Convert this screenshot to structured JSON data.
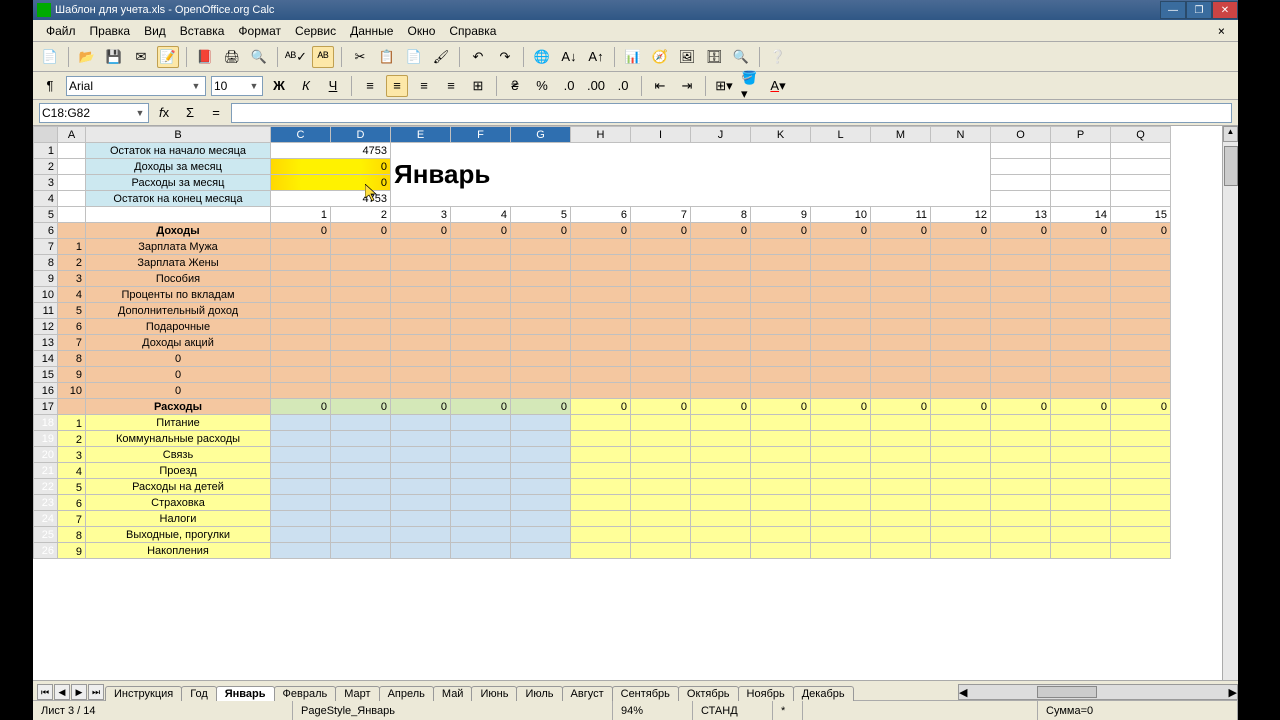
{
  "title": "Шаблон для учета.xls - OpenOffice.org Calc",
  "menu": [
    "Файл",
    "Правка",
    "Вид",
    "Вставка",
    "Формат",
    "Сервис",
    "Данные",
    "Окно",
    "Справка"
  ],
  "font": {
    "name": "Arial",
    "size": "10"
  },
  "cellref": "C18:G82",
  "formula": "",
  "cols": [
    "A",
    "B",
    "C",
    "D",
    "E",
    "F",
    "G",
    "H",
    "I",
    "J",
    "K",
    "L",
    "M",
    "N",
    "O",
    "P",
    "Q"
  ],
  "month_title": "Январь",
  "summary": [
    {
      "label": "Остаток на начало месяца",
      "val": "4753",
      "hl": false
    },
    {
      "label": "Доходы за месяц",
      "val": "0",
      "hl": true
    },
    {
      "label": "Расходы за месяц",
      "val": "0",
      "hl": true
    },
    {
      "label": "Остаток на конец месяца",
      "val": "4753",
      "hl": false
    }
  ],
  "daynums": [
    "1",
    "2",
    "3",
    "4",
    "5",
    "6",
    "7",
    "8",
    "9",
    "10",
    "11",
    "12",
    "13",
    "14",
    "15"
  ],
  "income_header": "Доходы",
  "income_zeros": [
    "0",
    "0",
    "0",
    "0",
    "0",
    "0",
    "0",
    "0",
    "0",
    "0",
    "0",
    "0",
    "0",
    "0",
    "0"
  ],
  "income_rows": [
    {
      "n": "1",
      "label": "Зарплата Мужа"
    },
    {
      "n": "2",
      "label": "Зарплата Жены"
    },
    {
      "n": "3",
      "label": "Пособия"
    },
    {
      "n": "4",
      "label": "Проценты по вкладам"
    },
    {
      "n": "5",
      "label": "Дополнительный доход"
    },
    {
      "n": "6",
      "label": "Подарочные"
    },
    {
      "n": "7",
      "label": "Доходы акций"
    },
    {
      "n": "8",
      "label": "0"
    },
    {
      "n": "9",
      "label": "0"
    },
    {
      "n": "10",
      "label": "0"
    }
  ],
  "expense_header": "Расходы",
  "expense_zeros": [
    "0",
    "0",
    "0",
    "0",
    "0",
    "0",
    "0",
    "0",
    "0",
    "0",
    "0",
    "0",
    "0",
    "0",
    "0"
  ],
  "expense_rows": [
    {
      "n": "1",
      "label": "Питание"
    },
    {
      "n": "2",
      "label": "Коммунальные расходы"
    },
    {
      "n": "3",
      "label": "Связь"
    },
    {
      "n": "4",
      "label": "Проезд"
    },
    {
      "n": "5",
      "label": "Расходы на детей"
    },
    {
      "n": "6",
      "label": "Страховка"
    },
    {
      "n": "7",
      "label": "Налоги"
    },
    {
      "n": "8",
      "label": "Выходные, прогулки"
    },
    {
      "n": "9",
      "label": "Накопления"
    }
  ],
  "tabs": [
    "Инструкция",
    "Год",
    "Январь",
    "Февраль",
    "Март",
    "Апрель",
    "Май",
    "Июнь",
    "Июль",
    "Август",
    "Сентябрь",
    "Октябрь",
    "Ноябрь",
    "Декабрь"
  ],
  "active_tab": "Январь",
  "status": {
    "sheet": "Лист 3 / 14",
    "style": "PageStyle_Январь",
    "zoom": "94%",
    "mode": "СТАНД",
    "mark": "*",
    "sum": "Сумма=0"
  }
}
